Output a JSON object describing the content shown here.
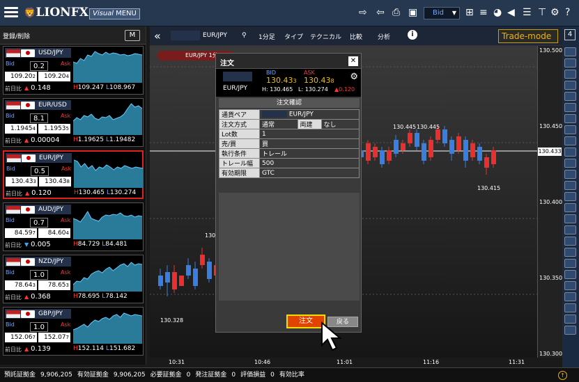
{
  "app": {
    "logo": "LIONFX",
    "visual_menu": "Visual",
    "visual_menu_suffix": "MENU",
    "price_type": "Bid"
  },
  "sidebar": {
    "header": "登録/削除",
    "m_button": "M",
    "prev_label": "前日比",
    "cards": [
      {
        "pair": "USD/JPY",
        "spread": "0.2",
        "bid_main": "109.20",
        "bid_pip": "2",
        "ask_main": "109.20",
        "ask_pip": "4",
        "change": "0.148",
        "dir": "up",
        "high": "109.247",
        "low": "108.967",
        "spark": [
          30,
          28,
          35,
          32,
          40,
          38,
          45,
          42,
          40,
          44,
          41,
          43,
          42,
          40,
          41,
          39,
          40,
          42,
          41,
          40
        ]
      },
      {
        "pair": "EUR/USD",
        "spread": "8.1",
        "bid_main": "1.1945",
        "bid_pip": "4",
        "ask_main": "1.1953",
        "ask_pip": "5",
        "change": "0.00004",
        "dir": "up",
        "high": "1.19625",
        "low": "1.19482",
        "spark": [
          20,
          25,
          22,
          28,
          26,
          30,
          24,
          22,
          26,
          25,
          28,
          22,
          24,
          26,
          30,
          38,
          45,
          40,
          42,
          38
        ]
      },
      {
        "pair": "EUR/JPY",
        "spread": "0.5",
        "bid_main": "130.43",
        "bid_pip": "3",
        "ask_main": "130.43",
        "ask_pip": "8",
        "change": "0.120",
        "dir": "up",
        "high": "130.465",
        "low": "130.274",
        "spark": [
          40,
          38,
          30,
          35,
          28,
          32,
          25,
          30,
          28,
          33,
          30,
          26,
          30,
          28,
          32,
          30,
          28,
          30,
          29,
          28
        ]
      },
      {
        "pair": "AUD/JPY",
        "spread": "0.7",
        "bid_main": "84.59",
        "bid_pip": "7",
        "ask_main": "84.60",
        "ask_pip": "4",
        "change": "0.005",
        "dir": "down",
        "high": "84.729",
        "low": "84.481",
        "spark": [
          30,
          28,
          25,
          32,
          40,
          30,
          28,
          26,
          32,
          35,
          34,
          36,
          35,
          38,
          34,
          33,
          35,
          32,
          34,
          33
        ]
      },
      {
        "pair": "NZD/JPY",
        "spread": "1.0",
        "bid_main": "78.64",
        "bid_pip": "3",
        "ask_main": "78.65",
        "ask_pip": "3",
        "change": "0.368",
        "dir": "up",
        "high": "78.695",
        "low": "78.142",
        "spark": [
          10,
          15,
          14,
          20,
          18,
          25,
          28,
          30,
          27,
          32,
          35,
          30,
          34,
          38,
          40,
          36,
          42,
          38,
          40,
          39
        ]
      },
      {
        "pair": "GBP/JPY",
        "spread": "1.0",
        "bid_main": "152.06",
        "bid_pip": "7",
        "ask_main": "152.07",
        "ask_pip": "7",
        "change": "0.139",
        "dir": "up",
        "high": "152.114",
        "low": "151.682",
        "spark": [
          20,
          22,
          25,
          28,
          24,
          30,
          34,
          32,
          36,
          38,
          35,
          40,
          42,
          38,
          44,
          42,
          40,
          42,
          41,
          40
        ]
      }
    ]
  },
  "chart_toolbar": {
    "pair": "EUR/JPY",
    "timeframe": "1分足",
    "type": "タイプ",
    "technical": "テクニカル",
    "compare": "比較",
    "analysis": "分析",
    "trade_mode": "Trade-mode",
    "page": "4"
  },
  "chart": {
    "tag": "EUR/JPY 1分",
    "axis": [
      "130.500",
      "130.450",
      "130.400",
      "130.350",
      "130.300"
    ],
    "current": "130.433",
    "annotations": [
      "130.445",
      "130.445",
      "130.415",
      "130.328",
      "130."
    ],
    "times": [
      "10:31",
      "10:46",
      "11:01",
      "11:16",
      "11:31"
    ]
  },
  "modal": {
    "title": "注文",
    "pair": "EUR/JPY",
    "bid_label": "BID",
    "ask_label": "ASK",
    "bid_main": "130.43",
    "bid_pip": "3",
    "ask_main": "130.43",
    "ask_pip": "8",
    "high": "H: 130.465",
    "low": "L: 130.274",
    "change": "0.120",
    "section": "注文確認",
    "rows": [
      {
        "k": "通貨ペア",
        "v": "EUR/JPY"
      },
      {
        "k": "注文方式",
        "v": "通常",
        "v2": "両建",
        "v3": "なし"
      },
      {
        "k": "Lot数",
        "v": "1"
      },
      {
        "k": "売/買",
        "v": "買"
      },
      {
        "k": "執行条件",
        "v": "トレール"
      },
      {
        "k": "トレール幅",
        "v": "500"
      },
      {
        "k": "有効期限",
        "v": "GTC"
      }
    ],
    "order_button": "注文",
    "back_button": "戻る"
  },
  "bottom": {
    "items": [
      "預託証拠金",
      "9,906,205",
      "有効証拠金",
      "9,906,205",
      "必要証拠金",
      "0",
      "発注証拠金",
      "0",
      "評価損益",
      "0",
      "有効比率"
    ]
  }
}
